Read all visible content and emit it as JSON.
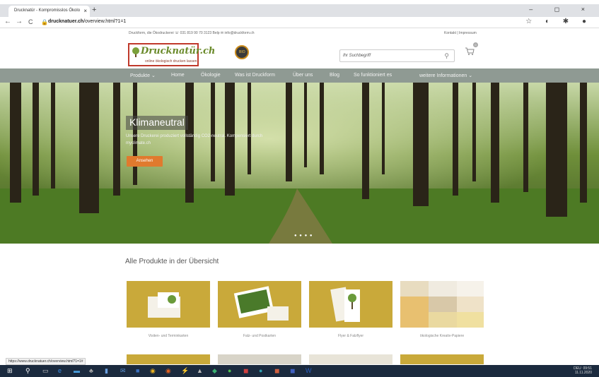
{
  "browser": {
    "tab_title": "Drucknatür - Kompromisslos Ökolo",
    "tab_close": "×",
    "new_tab": "+",
    "window_controls": "– ◻ ×",
    "url_host": "drucknatuer.ch",
    "url_path": "/overview.html?1=1",
    "nav_back": "←",
    "nav_forward": "→",
    "nav_reload": "C",
    "extensions": "☆ ◐ ✱ ●"
  },
  "topbar": {
    "info": "Druckform, die Ökodruckerei   ☏ 031 819 90 70   3123 Belp   ✉ info@druckform.ch",
    "right": "Kontakt | Impressum"
  },
  "header": {
    "logo_main": "Drucknatür.ch",
    "logo_sub": "online ökologisch drucken lassen",
    "seal_text": "BIO",
    "search_placeholder": "Ihr Suchbegriff",
    "search_icon": "⚲",
    "cart_icon": "🛒",
    "cart_count": "0"
  },
  "menu": {
    "items": [
      "Produkte ⌄",
      "Home",
      "Ökologie",
      "Was ist Druckform",
      "Über uns",
      "Blog",
      "So funktioniert es",
      "weitere Informationen ⌄"
    ]
  },
  "hero": {
    "title": "Klimaneutral",
    "subtitle": "Unsere Druckerei produziert vollständig CO2-neutral. Kompensiert durch myclimate.ch",
    "button": "Ansehen",
    "dots": "● ● ● ●"
  },
  "products": {
    "title": "Alle Produkte in der Übersicht",
    "items": [
      {
        "caption": "Visiten- und Terminkarten"
      },
      {
        "caption": "Falz- und Postkarten"
      },
      {
        "caption": "Flyer & Falzflyer"
      },
      {
        "caption": "ökologische Kreativ-Papiere"
      }
    ]
  },
  "status_url": "https://www.drucknatuer.ch/overview.html?1=1#",
  "taskbar": {
    "start": "⊞",
    "search": "⚲",
    "tray_time": "09:51",
    "tray_date": "11.11.2020",
    "tray_lang": "DEU"
  },
  "colors": {
    "menu_bg": "#8f9a93",
    "accent_orange": "#e07a2e",
    "card_yellow": "#c9a93a",
    "logo_border": "#c0392b"
  }
}
